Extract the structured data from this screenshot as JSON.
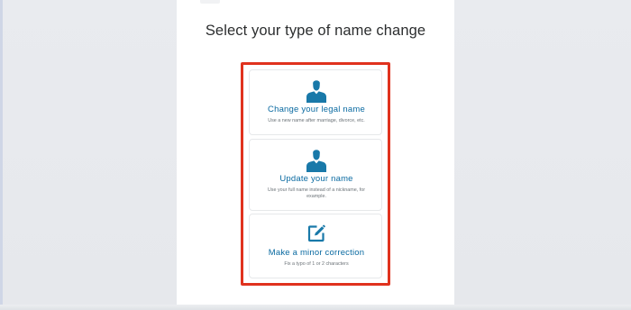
{
  "page": {
    "heading": "Select your type of name change"
  },
  "options": [
    {
      "title": "Change your legal name",
      "description": "Use a new name after marriage, divorce, etc.",
      "icon": "person-icon"
    },
    {
      "title": "Update your name",
      "description": "Use your full name instead of a nickname, for example.",
      "icon": "person-icon"
    },
    {
      "title": "Make a minor correction",
      "description": "Fix a typo of 1 or 2 characters",
      "icon": "edit-icon"
    }
  ],
  "colors": {
    "accent": "#0a6aa1",
    "icon": "#1979a9",
    "highlight": "#e0321e",
    "heading": "#2c2e2f",
    "muted": "#6c7378",
    "background": "#e8eaee"
  }
}
